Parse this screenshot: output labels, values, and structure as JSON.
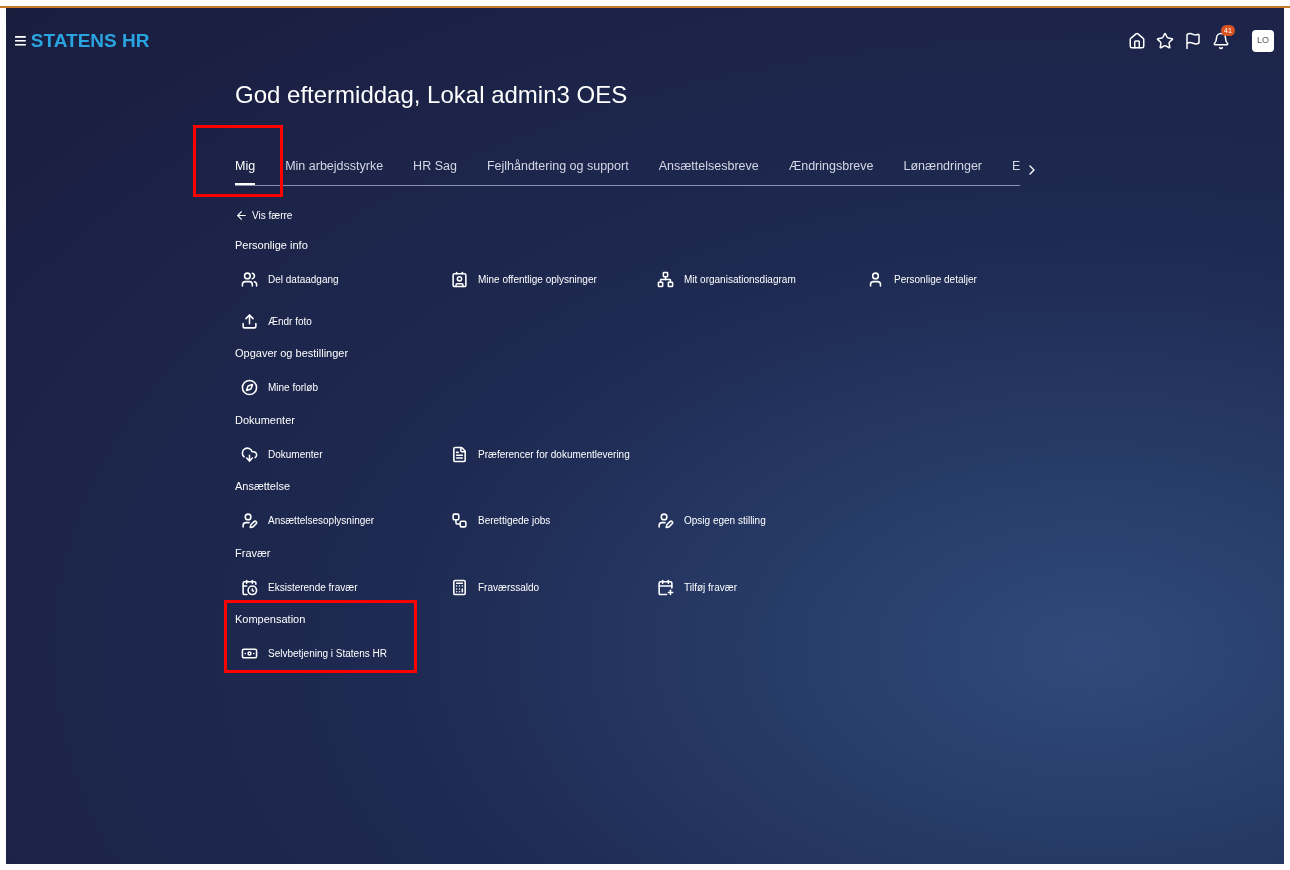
{
  "header": {
    "logo_menu": "≡",
    "logo": "STATENS HR",
    "notifications_badge": "41",
    "avatar": "LO"
  },
  "greeting": "God eftermiddag, Lokal admin3 OES",
  "tabs": [
    {
      "label": "Mig",
      "selected": true,
      "highlighted": true
    },
    {
      "label": "Min arbejdsstyrke",
      "selected": false,
      "highlighted": false
    },
    {
      "label": "HR Sag",
      "selected": false,
      "highlighted": false
    },
    {
      "label": "Fejlhåndtering og support",
      "selected": false,
      "highlighted": false
    },
    {
      "label": "Ansættelsesbreve",
      "selected": false,
      "highlighted": false
    },
    {
      "label": "Ændringsbreve",
      "selected": false,
      "highlighted": false
    },
    {
      "label": "Lønændringer",
      "selected": false,
      "highlighted": false
    },
    {
      "label": "E",
      "selected": false,
      "highlighted": false
    }
  ],
  "show_less": "Vis færre",
  "sections": [
    {
      "title": "Personlige info",
      "highlighted": false,
      "items": [
        {
          "label": "Del dataadgang"
        },
        {
          "label": "Mine offentlige oplysninger"
        },
        {
          "label": "Mit organisationsdiagram"
        },
        {
          "label": "Personlige detaljer"
        },
        {
          "label": "Ændr foto"
        }
      ]
    },
    {
      "title": "Opgaver og bestillinger",
      "highlighted": false,
      "items": [
        {
          "label": "Mine forløb"
        }
      ]
    },
    {
      "title": "Dokumenter",
      "highlighted": false,
      "items": [
        {
          "label": "Dokumenter"
        },
        {
          "label": "Præferencer for dokumentlevering"
        }
      ]
    },
    {
      "title": "Ansættelse",
      "highlighted": false,
      "items": [
        {
          "label": "Ansættelsesoplysninger"
        },
        {
          "label": "Berettigede jobs"
        },
        {
          "label": "Opsig egen stilling"
        }
      ]
    },
    {
      "title": "Fravær",
      "highlighted": false,
      "items": [
        {
          "label": "Eksisterende fravær"
        },
        {
          "label": "Fraværssaldo"
        },
        {
          "label": "Tilføj fravær"
        }
      ]
    },
    {
      "title": "Kompensation",
      "highlighted": true,
      "items": [
        {
          "label": "Selvbetjening i Statens HR"
        }
      ]
    }
  ]
}
